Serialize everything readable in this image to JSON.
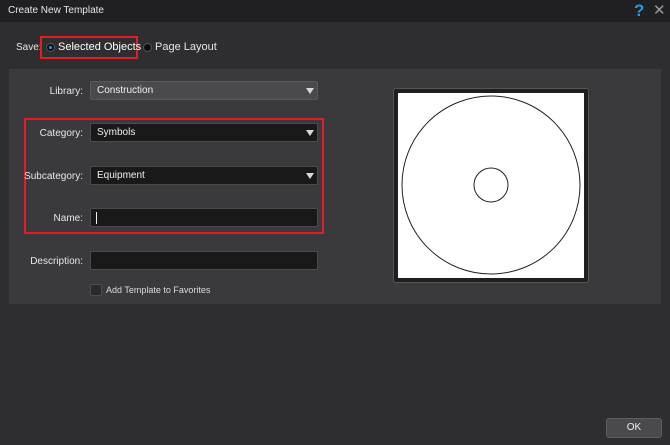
{
  "window": {
    "title": "Create New Template",
    "help_icon": "?",
    "close_icon": "✕"
  },
  "save": {
    "label": "Save:",
    "options": [
      {
        "label": "Selected Objects",
        "selected": true
      },
      {
        "label": "Page Layout",
        "selected": false
      }
    ]
  },
  "form": {
    "library": {
      "label": "Library:",
      "value": "Construction"
    },
    "category": {
      "label": "Category:",
      "value": "Symbols"
    },
    "subcategory": {
      "label": "Subcategory:",
      "value": "Equipment"
    },
    "name": {
      "label": "Name:",
      "value": ""
    },
    "description": {
      "label": "Description:",
      "value": ""
    },
    "favorites": {
      "label": "Add Template to Favorites",
      "checked": false
    }
  },
  "preview": {
    "icon": "preview-concentric-circles"
  },
  "buttons": {
    "ok": "OK"
  },
  "colors": {
    "accent": "#1f9be8",
    "highlight": "#e01e25"
  }
}
